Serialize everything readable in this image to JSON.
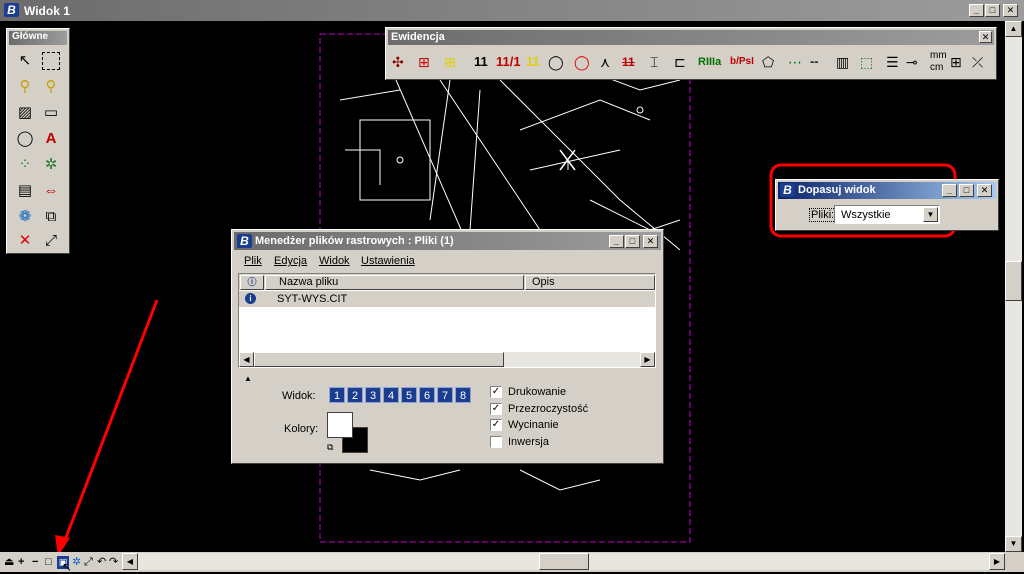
{
  "window": {
    "title": "Widok 1"
  },
  "glowne": {
    "title": "Główne"
  },
  "ewidencja": {
    "title": "Ewidencja",
    "labels": [
      "11",
      "11/1",
      "11",
      "RIIIa",
      "b/PsI",
      "mm",
      "cm"
    ]
  },
  "dopasuj": {
    "title": "Dopasuj widok",
    "pliki_label": "Pliki:",
    "select_value": "Wszystkie"
  },
  "manager": {
    "title": "Menedżer plików rastrowych : Pliki (1)",
    "menu": [
      "Plik",
      "Edycja",
      "Widok",
      "Ustawienia"
    ],
    "columns": [
      "Nazwa pliku",
      "Opis"
    ],
    "rows": [
      {
        "name": "SYT-WYS.CIT",
        "opis": ""
      }
    ],
    "widok_label": "Widok:",
    "view_buttons": [
      "1",
      "2",
      "3",
      "4",
      "5",
      "6",
      "7",
      "8"
    ],
    "kolory_label": "Kolory:",
    "options": [
      {
        "label": "Drukowanie",
        "checked": true
      },
      {
        "label": "Przezroczystość",
        "checked": true
      },
      {
        "label": "Wycinanie",
        "checked": true
      },
      {
        "label": "Inwersja",
        "checked": false
      }
    ]
  },
  "colors": {
    "annotation": "#ff0000",
    "border": "#c800c8",
    "selection": "#0a246a"
  }
}
